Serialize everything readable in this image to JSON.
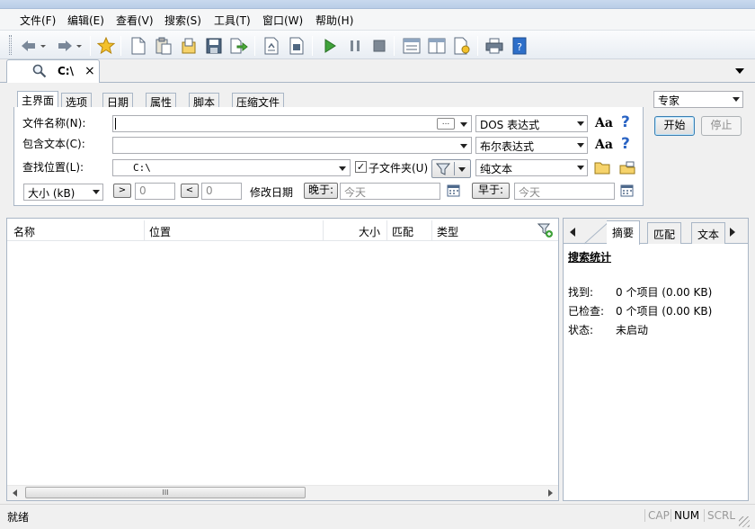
{
  "menu": [
    "文件(F)",
    "编辑(E)",
    "查看(V)",
    "搜索(S)",
    "工具(T)",
    "窗口(W)",
    "帮助(H)"
  ],
  "doc_tab": {
    "title": "C:\\",
    "close": "×"
  },
  "search_tabs": [
    "主界面",
    "选项",
    "日期",
    "属性",
    "脚本",
    "压缩文件"
  ],
  "form": {
    "filename_label": "文件名称(N):",
    "filename_value": "",
    "filename_ellipsis": "...",
    "filename_mode": "DOS 表达式",
    "contains_label": "包含文本(C):",
    "contains_value": "",
    "contains_mode": "布尔表达式",
    "location_label": "查找位置(L):",
    "location_value": "C:\\",
    "subfolders_label": "子文件夹(U)",
    "subfolders_checked": true,
    "text_type": "纯文本",
    "size_unit": "大小 (kB)",
    "gt": ">",
    "gt_value": "0",
    "lt": "<",
    "lt_value": "0",
    "date_label": "修改日期",
    "after_label": "晚于:",
    "after_value": "今天",
    "before_label": "早于:",
    "before_value": "今天"
  },
  "mode_select": "专家",
  "start_button": "开始",
  "stop_button": "停止",
  "columns": [
    "名称",
    "位置",
    "大小",
    "匹配",
    "类型"
  ],
  "scroll_thumb": "III",
  "right_tabs": [
    "摘要",
    "匹配",
    "文本"
  ],
  "stats": {
    "title": "搜索统计",
    "found_label": "找到:",
    "found_value": "0 个项目 (0.00 KB)",
    "checked_label": "已检查:",
    "checked_value": "0 个项目 (0.00 KB)",
    "state_label": "状态:",
    "state_value": "未启动"
  },
  "status": {
    "text": "就绪",
    "cap": "CAP",
    "num": "NUM",
    "scrl": "SCRL"
  },
  "colors": {
    "accent": "#2a64c4",
    "border": "#a9b6c6"
  }
}
